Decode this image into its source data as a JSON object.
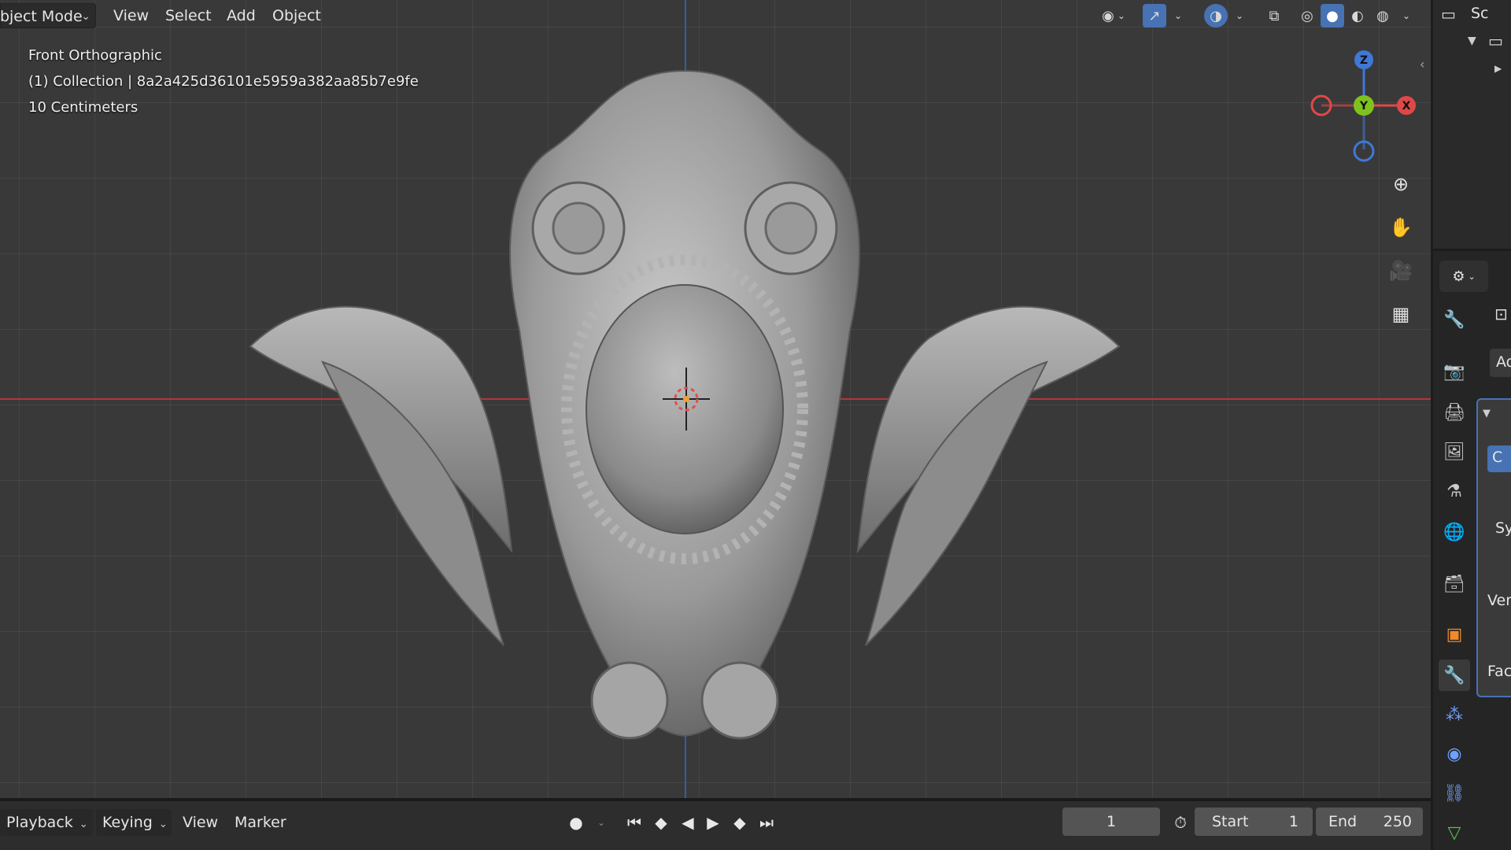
{
  "header": {
    "mode_label": "Object Mode",
    "menus": [
      "View",
      "Select",
      "Add",
      "Object"
    ]
  },
  "viewport": {
    "view_name": "Front Orthographic",
    "collection_info": "(1) Collection | 8a2a425d36101e5959a382aa85b7e9fe",
    "grid_scale": "10 Centimeters",
    "gizmo": {
      "z": "Z",
      "y": "Y",
      "x": "X"
    },
    "colors": {
      "x_axis": "#b0383f",
      "z_axis": "#2f5fa8",
      "gizmo_x": "#e04848",
      "gizmo_y": "#7fc21e",
      "gizmo_z": "#3f78d6"
    }
  },
  "properties": {
    "cut_labels": [
      "Sc",
      "Ad",
      "C",
      "Sy",
      "Ver",
      "Fac"
    ]
  },
  "timeline": {
    "menus": {
      "playback": "Playback",
      "keying": "Keying",
      "view": "View",
      "marker": "Marker"
    },
    "current_frame": "1",
    "start_label": "Start",
    "start_value": "1",
    "end_label": "End",
    "end_value": "250"
  }
}
